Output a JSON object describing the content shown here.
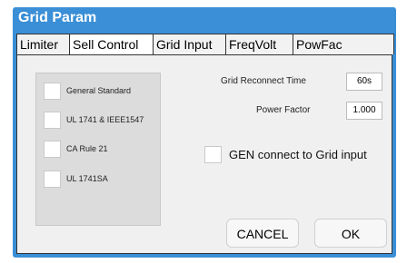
{
  "window": {
    "title": "Grid Param"
  },
  "tabs": [
    {
      "label": "Limiter"
    },
    {
      "label": "Sell Control"
    },
    {
      "label": "Grid Input"
    },
    {
      "label": "FreqVolt"
    },
    {
      "label": "PowFac"
    }
  ],
  "standards": [
    {
      "label": "General Standard"
    },
    {
      "label": "UL 1741 & IEEE1547"
    },
    {
      "label": "CA Rule 21"
    },
    {
      "label": "UL 1741SA"
    }
  ],
  "reconnect": {
    "label": "Grid Reconnect Time",
    "value": "60s"
  },
  "power_factor": {
    "label": "Power Factor",
    "value": "1.000"
  },
  "gen_connect": {
    "label": "GEN connect to Grid input"
  },
  "buttons": {
    "cancel": "CANCEL",
    "ok": "OK"
  }
}
